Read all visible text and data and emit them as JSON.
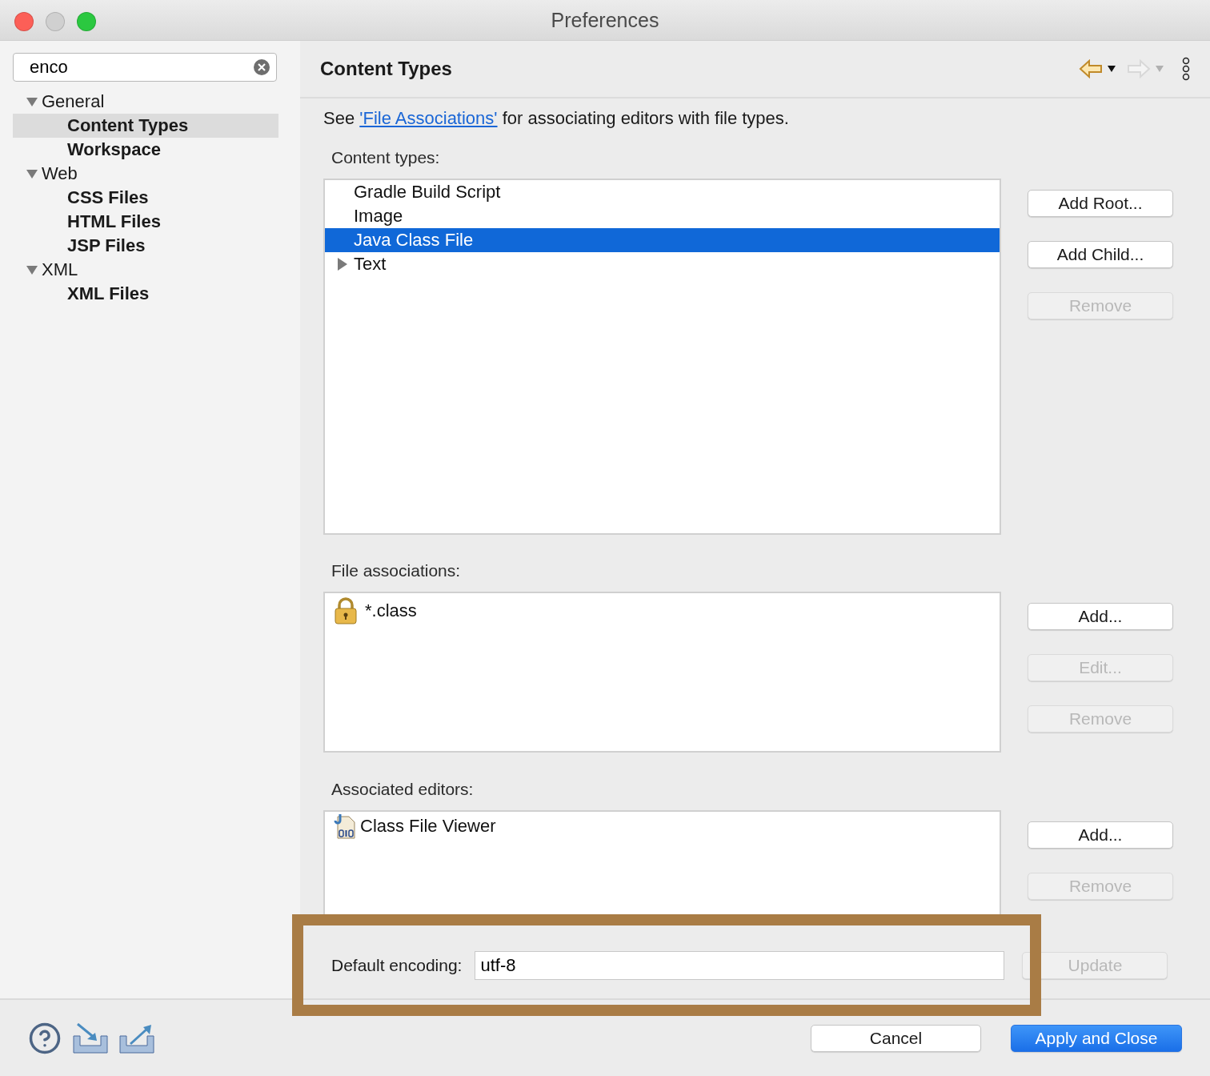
{
  "window": {
    "title": "Preferences"
  },
  "search": {
    "value": "enco"
  },
  "tree": [
    {
      "label": "General",
      "expanded": true,
      "selected": false,
      "children": [
        {
          "label": "Content Types",
          "selected": true
        },
        {
          "label": "Workspace",
          "selected": false
        }
      ]
    },
    {
      "label": "Web",
      "expanded": true,
      "selected": false,
      "children": [
        {
          "label": "CSS Files",
          "selected": false
        },
        {
          "label": "HTML Files",
          "selected": false
        },
        {
          "label": "JSP Files",
          "selected": false
        }
      ]
    },
    {
      "label": "XML",
      "expanded": true,
      "selected": false,
      "children": [
        {
          "label": "XML Files",
          "selected": false
        }
      ]
    }
  ],
  "page": {
    "title": "Content Types"
  },
  "nav": [
    {
      "kind": "back",
      "disabled": false
    },
    {
      "kind": "forward",
      "disabled": true
    }
  ],
  "intro": {
    "before": "See",
    "link": "'File Associations'",
    "after": "for associating editors with file types."
  },
  "content_types": {
    "label": "Content types:",
    "items": [
      {
        "label": "Gradle Build Script",
        "selected": false,
        "expandable": false
      },
      {
        "label": "Image",
        "selected": false,
        "expandable": false
      },
      {
        "label": "Java Class File",
        "selected": true,
        "expandable": false
      },
      {
        "label": "Text",
        "selected": false,
        "expandable": true
      }
    ],
    "buttons": [
      {
        "label": "Add Root...",
        "disabled": false
      },
      {
        "label": "Add Child...",
        "disabled": false
      },
      {
        "label": "Remove",
        "disabled": true
      }
    ]
  },
  "file_associations": {
    "label": "File associations:",
    "items": [
      {
        "label": "*.class",
        "kind": "locked"
      }
    ],
    "buttons": [
      {
        "label": "Add...",
        "disabled": false
      },
      {
        "label": "Edit...",
        "disabled": true
      },
      {
        "label": "Remove",
        "disabled": true
      }
    ]
  },
  "associated_editors": {
    "label": "Associated editors:",
    "items": [
      {
        "label": "Class File Viewer",
        "kind": "classfile"
      }
    ],
    "buttons": [
      {
        "label": "Add...",
        "disabled": false
      },
      {
        "label": "Remove",
        "disabled": true
      }
    ]
  },
  "encoding": {
    "label": "Default encoding:",
    "value": "utf-8",
    "button": {
      "label": "Update",
      "disabled": true
    }
  },
  "footer": {
    "buttons": [
      {
        "label": "Cancel",
        "kind": "normal"
      },
      {
        "label": "Apply and Close",
        "kind": "default"
      }
    ]
  }
}
